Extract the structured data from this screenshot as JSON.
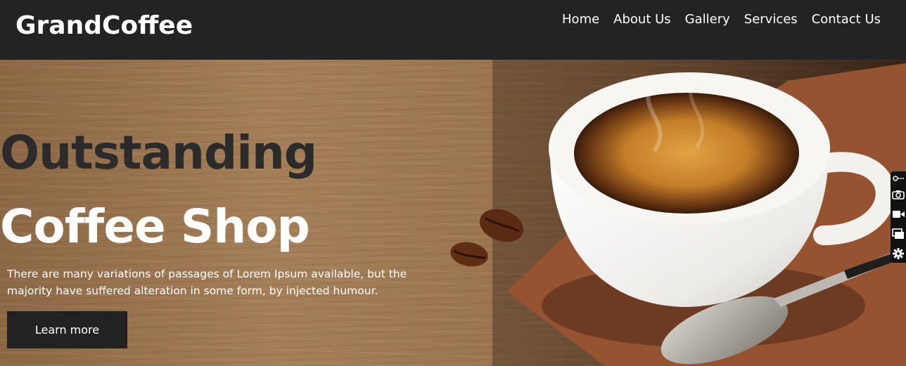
{
  "header": {
    "logo": "GrandCoffee",
    "nav": [
      {
        "label": "Home"
      },
      {
        "label": "About Us"
      },
      {
        "label": "Gallery"
      },
      {
        "label": "Services"
      },
      {
        "label": "Contact Us"
      }
    ]
  },
  "hero": {
    "headline_line1": "Outstanding",
    "headline_line2": "Coffee Shop",
    "description": "There are many variations of passages of Lorem Ipsum available, but the majority have suffered alteration in some form, by injected humour.",
    "cta_label": "Learn more"
  },
  "side_tools": [
    {
      "icon": "link-icon"
    },
    {
      "icon": "camera-icon"
    },
    {
      "icon": "video-icon"
    },
    {
      "icon": "window-icon"
    },
    {
      "icon": "gear-icon"
    }
  ],
  "colors": {
    "topbar": "#232323",
    "button": "#222222",
    "headline_dark": "#2b2b2b",
    "text_light": "#ffffff"
  }
}
